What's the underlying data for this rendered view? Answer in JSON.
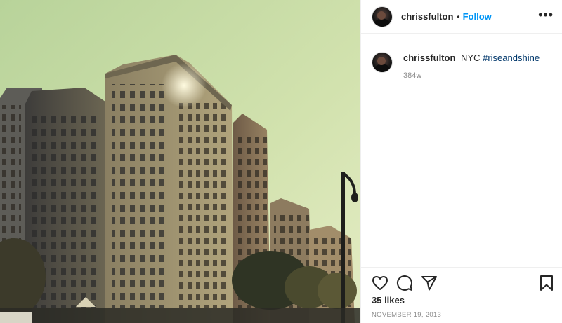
{
  "post": {
    "photo_alt": "Photo",
    "username": "chrissfulton",
    "separator": "•",
    "follow_label": "Follow",
    "more_label": "•••",
    "caption_text": "NYC",
    "caption_hashtag": "#riseandshine",
    "caption_age": "384w",
    "likes": "35 likes",
    "date": "NOVEMBER 19, 2013"
  },
  "icons": {
    "like": "heart-icon",
    "comment": "comment-icon",
    "share": "paper-plane-icon",
    "save": "bookmark-icon",
    "more": "more-options-icon"
  },
  "colors": {
    "link": "#0095f6",
    "hashtag": "#00376b",
    "text": "#262626",
    "muted": "#8e8e8e"
  }
}
